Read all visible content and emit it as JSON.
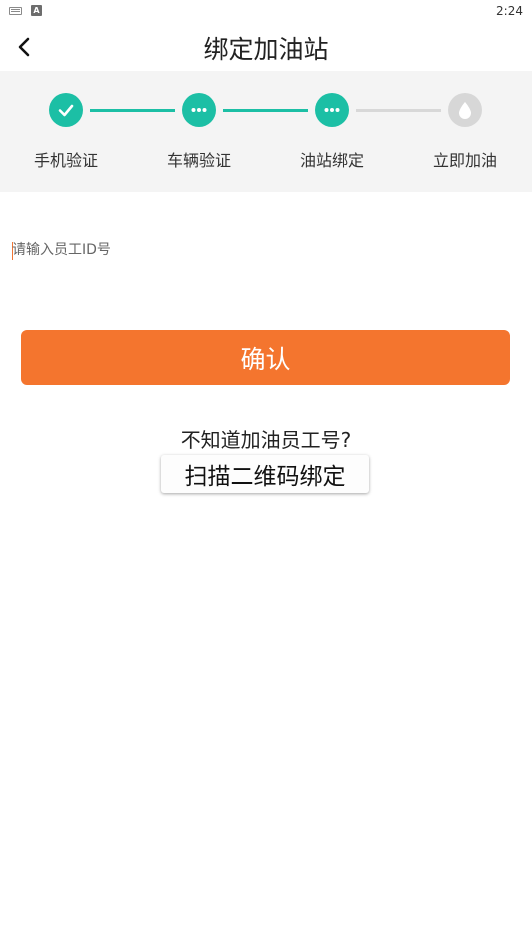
{
  "status_bar": {
    "time": "2:24",
    "badge": "A"
  },
  "header": {
    "title": "绑定加油站"
  },
  "stepper": {
    "steps": [
      {
        "label": "手机验证",
        "state": "done",
        "icon": "check-icon"
      },
      {
        "label": "车辆验证",
        "state": "active",
        "icon": "more-dots-icon"
      },
      {
        "label": "油站绑定",
        "state": "active",
        "icon": "more-dots-icon"
      },
      {
        "label": "立即加油",
        "state": "pending",
        "icon": "water-drop-icon"
      }
    ],
    "colors": {
      "active": "#1cbfa5",
      "inactive": "#d7d7d7"
    }
  },
  "form": {
    "employee_id": {
      "value": "",
      "placeholder": "请输入员工ID号"
    },
    "confirm_label": "确认",
    "hint_text": "不知道加油员工号?",
    "scan_label": "扫描二维码绑定"
  },
  "colors": {
    "primary": "#f4752e",
    "accent": "#1cbfa5"
  }
}
